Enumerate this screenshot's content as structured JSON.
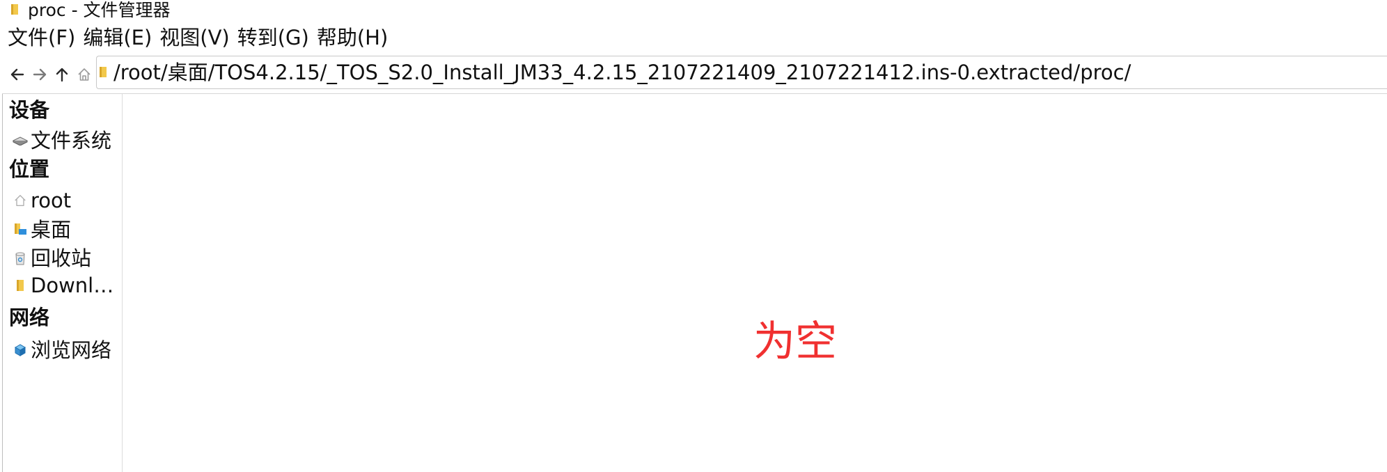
{
  "window": {
    "title": "proc - 文件管理器",
    "folder_icon": "folder-icon"
  },
  "menubar": {
    "items": [
      {
        "label": "文件(F)"
      },
      {
        "label": "编辑(E)"
      },
      {
        "label": "视图(V)"
      },
      {
        "label": "转到(G)"
      },
      {
        "label": "帮助(H)"
      }
    ]
  },
  "navbar": {
    "back_icon": "arrow-left-icon",
    "forward_icon": "arrow-right-icon",
    "up_icon": "arrow-up-icon",
    "home_icon": "home-icon",
    "path": "/root/桌面/TOS4.2.15/_TOS_S2.0_Install_JM33_4.2.15_2107221409_2107221412.ins-0.extracted/proc/"
  },
  "sidebar": {
    "sections": [
      {
        "header": "设备",
        "items": [
          {
            "label": "文件系统",
            "icon": "drive-icon"
          }
        ]
      },
      {
        "header": "位置",
        "items": [
          {
            "label": "root",
            "icon": "home-icon"
          },
          {
            "label": "桌面",
            "icon": "desktop-folder-icon"
          },
          {
            "label": "回收站",
            "icon": "trash-icon"
          },
          {
            "label": "Downl…",
            "icon": "folder-icon"
          }
        ]
      },
      {
        "header": "网络",
        "items": [
          {
            "label": "浏览网络",
            "icon": "network-icon"
          }
        ]
      }
    ]
  },
  "main": {
    "empty_note": "为空",
    "empty_note_color": "#f03030"
  },
  "colors": {
    "folder": "#f2c84b",
    "accent_red": "#f03030"
  }
}
